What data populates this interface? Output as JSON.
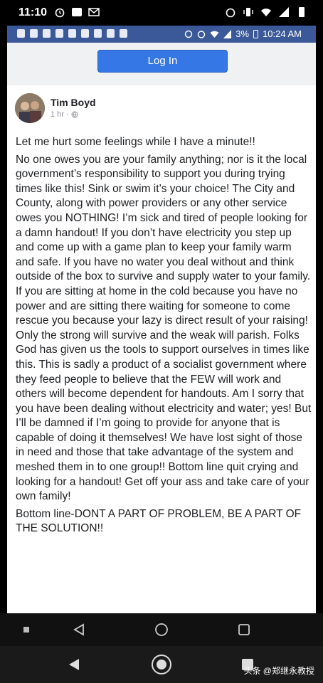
{
  "outer_status": {
    "time": "11:10"
  },
  "inner_status": {
    "battery": "3%",
    "time": "10:24 AM"
  },
  "login": {
    "label": "Log In"
  },
  "post": {
    "author": "Tim Boyd",
    "time": "1 hr",
    "paragraphs": [
      "Let me hurt some feelings while I have a minute!!",
      "No one owes you are your family anything; nor is it the local government’s responsibility to support you during trying times like this! Sink or swim it’s your choice! The City and County, along with power providers or any other service owes you NOTHING! I’m sick and tired of people looking for a damn handout! If you don’t have electricity you step up and come up with a game plan to keep your family warm and safe. If you have no water you deal without and think outside of the box to survive and supply water to your family. If you are sitting at home in the cold because you have no power and are sitting there waiting for someone to come rescue you because your lazy is direct result of your raising! Only the strong will survive and the weak will parish. Folks God has given us the tools to support ourselves in times like this. This is sadly a product of a socialist government where they feed people to believe that the FEW will work and others will become dependent for handouts. Am I sorry that you have been dealing without electricity and water; yes! But I’ll be damned if I’m going to provide for anyone that is capable of doing it themselves! We have lost sight of those in need and those that take advantage of the system and meshed them in to one group!! Bottom line quit crying and looking for a handout! Get off your ass and take care of your own family!",
      "Bottom line-DONT A PART OF PROBLEM, BE A PART OF THE SOLUTION!!"
    ]
  },
  "watermark": "头条 @郑继永教授",
  "colors": {
    "facebook_blue": "#3b5998",
    "button_blue": "#3578e5"
  },
  "icons": [
    "alarm-icon",
    "wifi-icon",
    "signal-icon",
    "battery-icon",
    "globe-icon",
    "back-icon",
    "home-icon",
    "recents-icon"
  ]
}
